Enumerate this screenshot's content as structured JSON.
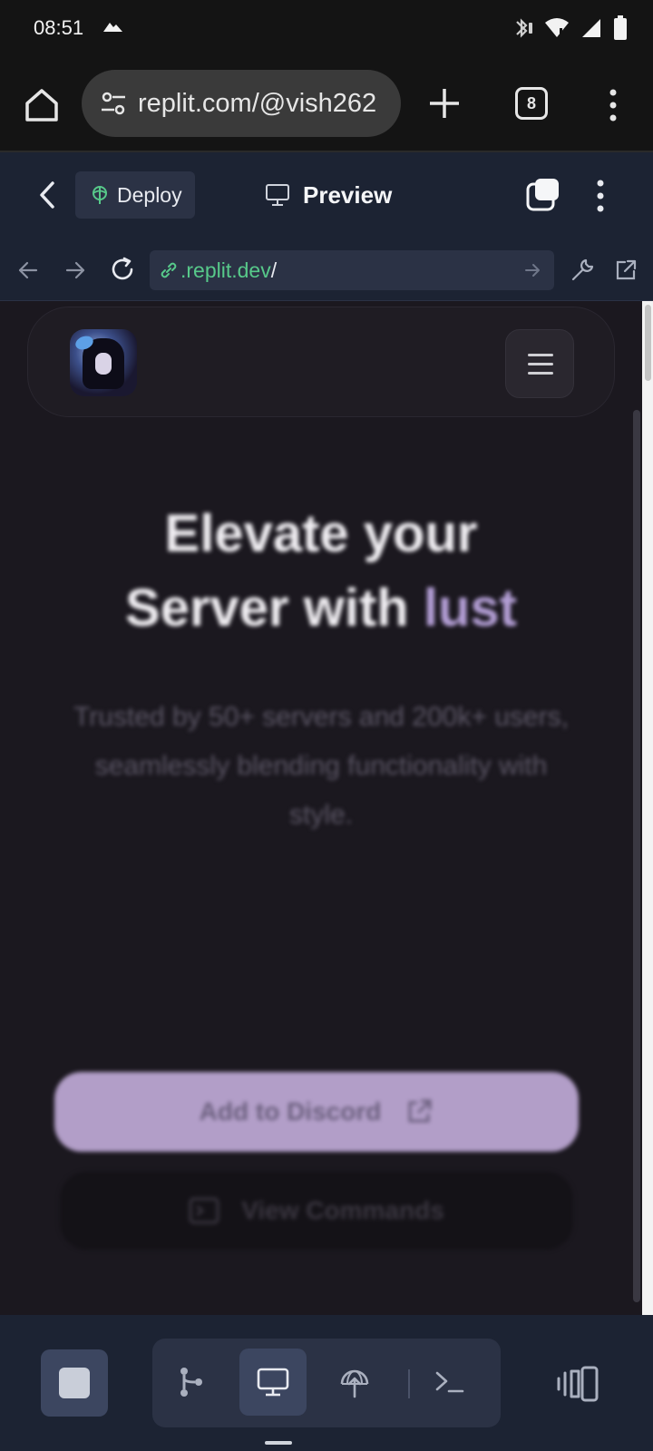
{
  "status_bar": {
    "time": "08:51",
    "left_icon": "mountain-icon",
    "right_icons": [
      "bluetooth-icon",
      "wifi-icon",
      "signal-icon",
      "battery-icon"
    ]
  },
  "browser": {
    "url": "replit.com/@vish262",
    "tab_count": "8",
    "icons": [
      "home-icon",
      "site-settings-icon",
      "new-tab-icon",
      "tab-switcher-icon",
      "overflow-menu-icon"
    ]
  },
  "replit_header": {
    "deploy_label": "Deploy",
    "preview_label": "Preview",
    "icons": [
      "back-chevron-icon",
      "deploy-icon",
      "monitor-icon",
      "window-icon",
      "overflow-menu-icon"
    ]
  },
  "webview": {
    "url_host": ".replit.dev",
    "url_path": "/",
    "icons": [
      "back-arrow-icon",
      "forward-arrow-icon",
      "reload-icon",
      "link-icon",
      "go-arrow-icon",
      "wrench-icon",
      "external-link-icon"
    ]
  },
  "site": {
    "hero_line1": "Elevate your",
    "hero_line2_prefix": "Server with ",
    "hero_accent": "lust",
    "subtitle": "Trusted by 50+ servers and 200k+ users, seamlessly blending functionality with style.",
    "primary_button": "Add to Discord",
    "secondary_button": "View Commands",
    "accent_color": "#b49fd6",
    "button_color": "#b29ec8",
    "background_color": "#1b181f"
  },
  "bottom_toolbar": {
    "tools": [
      "stop-icon",
      "git-icon",
      "monitor-icon",
      "deploy-icon",
      "terminal-icon",
      "panels-icon"
    ],
    "active_tool": "monitor-icon"
  }
}
